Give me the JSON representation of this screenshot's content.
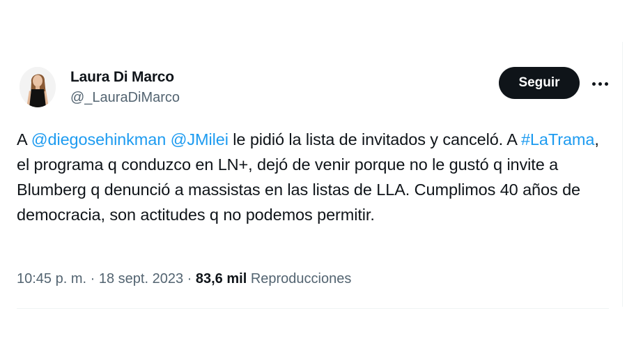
{
  "author": {
    "name": "Laura Di Marco",
    "handle": "@_LauraDiMarco"
  },
  "follow_button": {
    "label": "Seguir"
  },
  "more_menu": {
    "icon": "more-horizontal-icon"
  },
  "tweet": {
    "parts": {
      "p1": "A ",
      "mention1": "@diegosehinkman",
      "p2": " ",
      "mention2": "@JMilei",
      "p3": " le pidió la lista de invitados y canceló. A ",
      "hashtag": "#LaTrama",
      "p4": ", el programa q conduzco en LN+, dejó de venir porque no le gustó q invite a Blumberg q denunció a massistas en las listas de LLA. Cumplimos 40 años de democracia, son actitudes q no podemos permitir."
    }
  },
  "meta": {
    "time": "10:45 p. m.",
    "separator": "·",
    "date": "18 sept. 2023",
    "views_count": "83,6 mil",
    "views_label": "Reproducciones"
  },
  "colors": {
    "link": "#1d9bf0",
    "muted": "#536471",
    "text": "#0f1419"
  }
}
